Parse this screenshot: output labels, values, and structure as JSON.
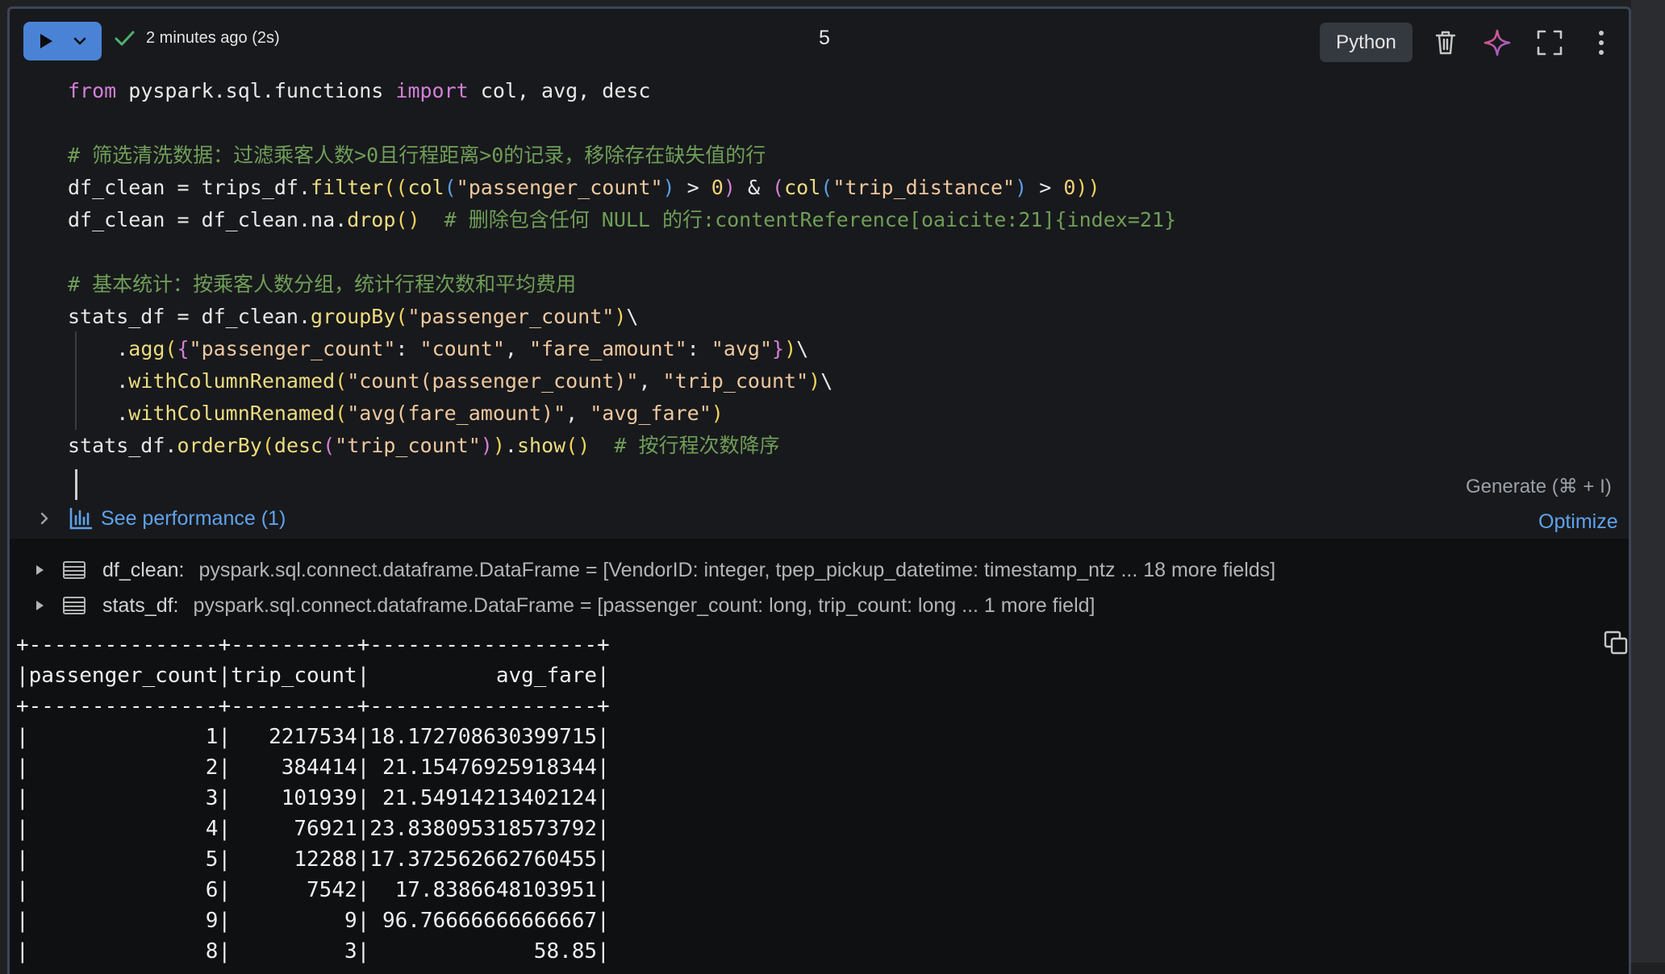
{
  "toolbar": {
    "status_text": "2 minutes ago (2s)",
    "cell_number": "5",
    "language": "Python",
    "icons": [
      "play-icon",
      "chevron-down-icon",
      "check-icon",
      "trash-icon",
      "sparkle-icon",
      "expand-icon",
      "more-vertical-icon"
    ]
  },
  "code": {
    "l1": {
      "a": "from",
      "b": " pyspark.sql.functions ",
      "c": "import",
      "d": " col, avg, desc"
    },
    "l3": "# 筛选清洗数据：过滤乘客人数>0且行程距离>0的记录，移除存在缺失值的行",
    "l4": {
      "a": "df_clean = trips_df.",
      "b": "filter",
      "c": "((",
      "d": "col",
      "e": "(",
      "f": "\"passenger_count\"",
      "g": ")",
      "h": " > ",
      "i": "0",
      "j": ")",
      "k": " & ",
      "l": "(",
      "m": "col",
      "n": "(",
      "o": "\"trip_distance\"",
      "p": ")",
      "q": " > ",
      "r": "0",
      "s": "))"
    },
    "l5": {
      "a": "df_clean = df_clean.na.",
      "b": "drop",
      "c": "()",
      "d": "  # 删除包含任何 NULL 的行:contentReference[oaicite:21]{index=21}"
    },
    "l7": "# 基本统计：按乘客人数分组，统计行程次数和平均费用",
    "l8": {
      "a": "stats_df = df_clean.",
      "b": "groupBy",
      "c": "(",
      "d": "\"passenger_count\"",
      "e": ")",
      "f": "\\"
    },
    "l9": {
      "a": "    .",
      "b": "agg",
      "c": "(",
      "d": "{",
      "e": "\"passenger_count\"",
      "f": ": ",
      "g": "\"count\"",
      "h": ", ",
      "i": "\"fare_amount\"",
      "j": ": ",
      "k": "\"avg\"",
      "l": "}",
      "m": ")",
      "n": "\\"
    },
    "l10": {
      "a": "    .",
      "b": "withColumnRenamed",
      "c": "(",
      "d": "\"count(passenger_count)\"",
      "e": ", ",
      "f": "\"trip_count\"",
      "g": ")",
      "h": "\\"
    },
    "l11": {
      "a": "    .",
      "b": "withColumnRenamed",
      "c": "(",
      "d": "\"avg(fare_amount)\"",
      "e": ", ",
      "f": "\"avg_fare\"",
      "g": ")"
    },
    "l12": {
      "a": "stats_df.",
      "b": "orderBy",
      "c": "(",
      "d": "desc",
      "e": "(",
      "f": "\"trip_count\"",
      "g": ")",
      "h": ")",
      "i": ".",
      "j": "show",
      "k": "()",
      "l": "  # 按行程次数降序"
    }
  },
  "generate_hint": "Generate (⌘ + I)",
  "performance": {
    "label": "See performance (1)",
    "optimize": "Optimize"
  },
  "outputs": [
    {
      "name": "df_clean:",
      "type": "pyspark.sql.connect.dataframe.DataFrame = [VendorID: integer, tpep_pickup_datetime: timestamp_ntz ... 18 more fields]"
    },
    {
      "name": "stats_df:",
      "type": "pyspark.sql.connect.dataframe.DataFrame = [passenger_count: long, trip_count: long ... 1 more field]"
    }
  ],
  "result_table": {
    "border": "+---------------+----------+------------------+",
    "header": "|passenger_count|trip_count|          avg_fare|",
    "rows": [
      "|              1|   2217534|18.172708630399715|",
      "|              2|    384414| 21.15476925918344|",
      "|              3|    101939| 21.54914213402124|",
      "|              4|     76921|23.838095318573792|",
      "|              5|     12288|17.372562662760455|",
      "|              6|      7542|  17.8386648103951|",
      "|              9|         9| 96.76666666666667|",
      "|              8|         3|             58.85|"
    ]
  },
  "colors": {
    "run_button": "#4a83d6",
    "link": "#5ea2ec",
    "keyword": "#d37fd7",
    "comment": "#6f9e58"
  }
}
